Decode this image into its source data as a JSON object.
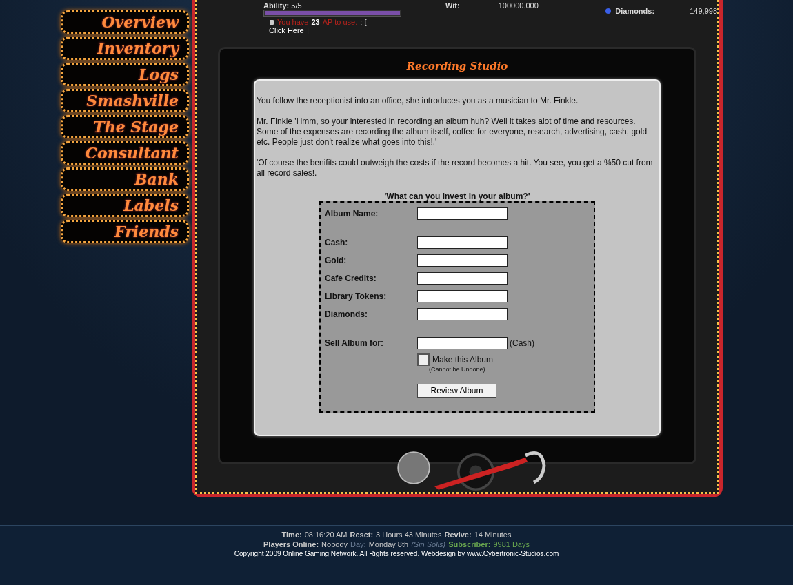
{
  "nav": [
    {
      "label": "Overview"
    },
    {
      "label": "Inventory"
    },
    {
      "label": "Logs"
    },
    {
      "label": "Smashville"
    },
    {
      "label": "The Stage"
    },
    {
      "label": "Consultant"
    },
    {
      "label": "Bank"
    },
    {
      "label": "Labels"
    },
    {
      "label": "Friends"
    }
  ],
  "stats": {
    "ability": {
      "label": "Ability:",
      "value": "5/5",
      "level": 1
    },
    "ap_line": [
      {
        "kind": "warn",
        "text": "You have"
      },
      {
        "kind": "strong",
        "text": "23"
      },
      {
        "kind": "warn",
        "text": "AP to use."
      },
      {
        "kind": "plain",
        "text": ": ["
      },
      {
        "kind": "link",
        "text": "Click Here"
      },
      {
        "kind": "plain",
        "text": "]"
      }
    ],
    "wit": {
      "label": "Wit:",
      "value": "100000.000"
    },
    "diamonds": {
      "label": "Diamonds:",
      "value": "149,998"
    }
  },
  "page_title": "Recording Studio",
  "paragraphs": [
    "You follow the receptionist into an office, she introduces you as a musician to Mr. Finkle.",
    "Mr. Finkle 'Hmm, so your interested in recording an album huh? Well it takes alot of time and resources. Some of the expenses are recording the album itself, coffee for everyone, research, advertising, cash, gold etc. People just don't realize what goes into this!.'",
    "'Of course the benifits could outweigh the costs if the record becomes a hit. You see, you get a %50 cut from all record sales!."
  ],
  "form": {
    "heading": "'What can you invest in your album?'",
    "field_groups": [
      [
        {
          "label": "Album Name:"
        }
      ],
      [
        {
          "label": "Cash:"
        },
        {
          "label": "Gold:"
        },
        {
          "label": "Cafe Credits:"
        },
        {
          "label": "Library Tokens:"
        },
        {
          "label": "Diamonds:"
        }
      ]
    ],
    "sell": {
      "label": "Sell Album for:",
      "suffix": "(Cash)"
    },
    "confirm": {
      "label": "Make this Album",
      "note": "(Cannot be Undone)",
      "checked": false
    },
    "submit": "Review Album"
  },
  "footer": [
    [
      {
        "kind": "label",
        "text": "Time:"
      },
      {
        "kind": "value",
        "text": "08:16:20 AM"
      },
      {
        "kind": "label",
        "text": "Reset:"
      },
      {
        "kind": "value",
        "text": "3 Hours 43 Minutes"
      },
      {
        "kind": "label",
        "text": "Revive:"
      },
      {
        "kind": "value",
        "text": "14 Minutes"
      }
    ],
    [
      {
        "kind": "label",
        "text": "Players Online:"
      },
      {
        "kind": "value",
        "text": "Nobody"
      },
      {
        "kind": "dim",
        "text": "Day:"
      },
      {
        "kind": "value",
        "text": "Monday 8th"
      },
      {
        "kind": "dim-italic",
        "text": "(Sin Solis)"
      },
      {
        "kind": "green-label",
        "text": "Subscriber:"
      },
      {
        "kind": "green",
        "text": "9981 Days"
      }
    ]
  ],
  "copyright": "Copyright 2009 Online Gaming Network. All Rights reserved. Webdesign by www.Cybertronic-Studios.com"
}
